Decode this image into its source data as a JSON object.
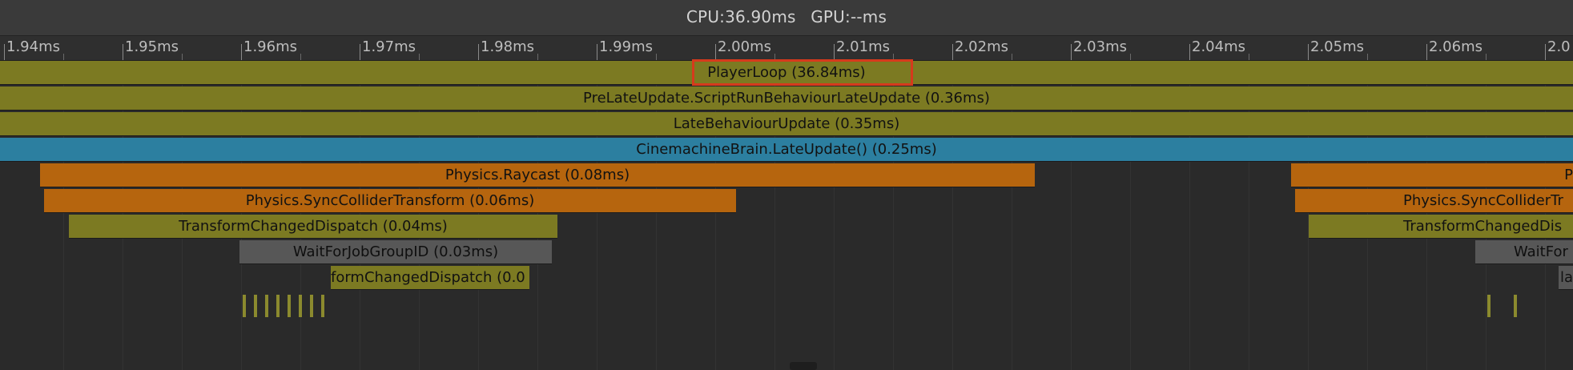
{
  "header": {
    "cpu": "CPU:36.90ms",
    "gpu": "GPU:--ms"
  },
  "ruler": {
    "ticks": [
      "1.94ms",
      "1.95ms",
      "1.96ms",
      "1.97ms",
      "1.98ms",
      "1.99ms",
      "2.00ms",
      "2.01ms",
      "2.02ms",
      "2.03ms",
      "2.04ms",
      "2.05ms",
      "2.06ms",
      "2.0"
    ]
  },
  "bars": {
    "player_loop": "PlayerLoop (36.84ms)",
    "pre_late_update": "PreLateUpdate.ScriptRunBehaviourLateUpdate (0.36ms)",
    "late_behaviour_update": "LateBehaviourUpdate (0.35ms)",
    "cinemachine": "CinemachineBrain.LateUpdate() (0.25ms)",
    "physics_raycast_left": "Physics.Raycast (0.08ms)",
    "physics_raycast_right": "P",
    "physics_sync_left": "Physics.SyncColliderTransform (0.06ms)",
    "physics_sync_right": "Physics.SyncColliderTr",
    "transform_changed_left": "TransformChangedDispatch (0.04ms)",
    "transform_changed_right": "TransformChangedDis",
    "wait_job_left": "WaitForJobGroupID (0.03ms)",
    "wait_job_right": "WaitFor",
    "transform_changed_small": "formChangedDispatch (0.0",
    "small_right": "la"
  },
  "colors": {
    "olive": "#7c7a22",
    "blue": "#2c7fa0",
    "orange": "#b6650e",
    "gray": "#575757",
    "highlight": "#d63a1c"
  },
  "icons": []
}
